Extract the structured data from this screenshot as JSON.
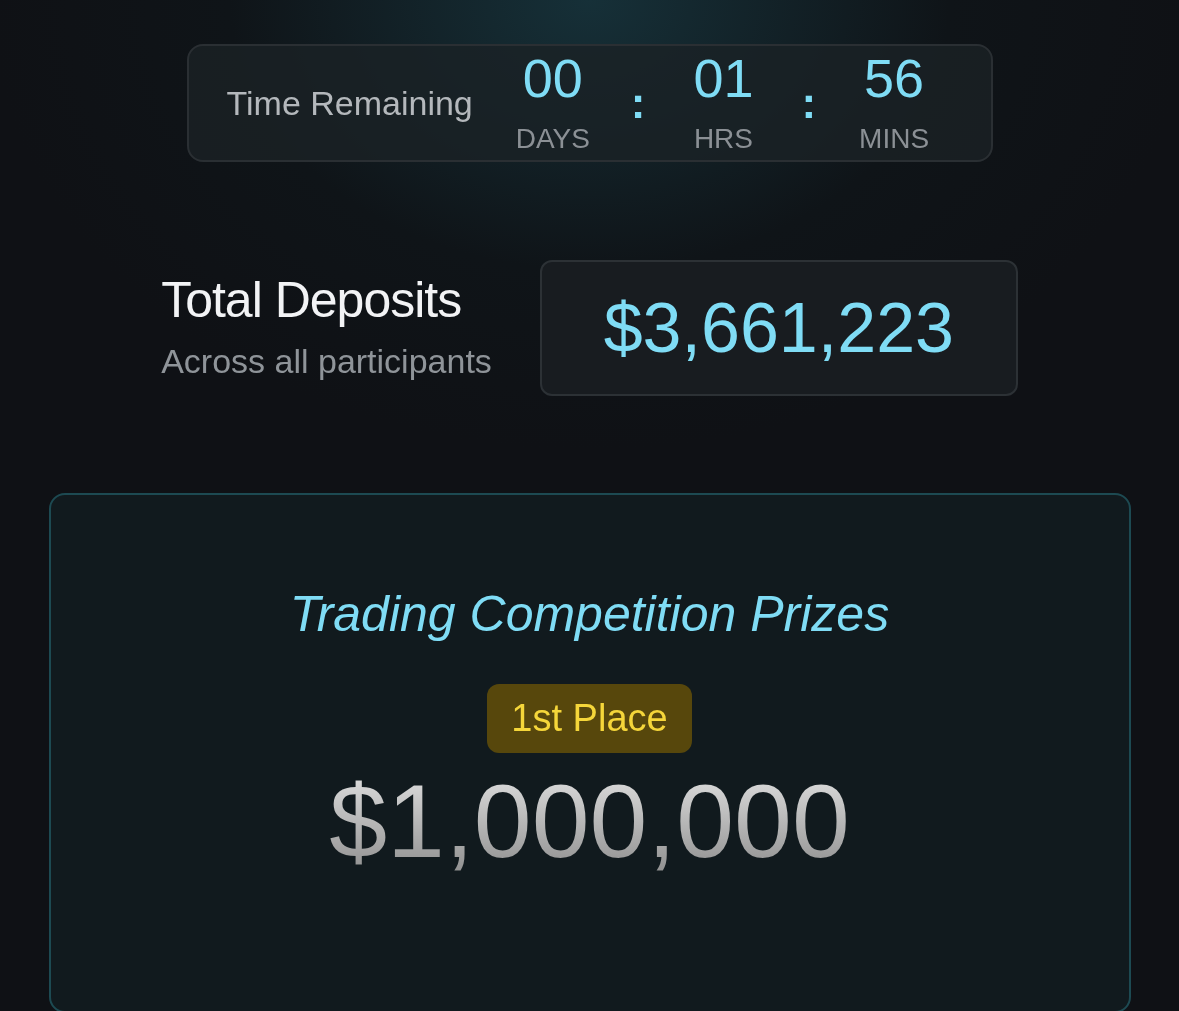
{
  "countdown": {
    "label": "Time Remaining",
    "units": [
      {
        "value": "00",
        "unit": "DAYS"
      },
      {
        "value": "01",
        "unit": "HRS"
      },
      {
        "value": "56",
        "unit": "MINS"
      }
    ],
    "separators": [
      ":",
      ":"
    ]
  },
  "deposits": {
    "title": "Total Deposits",
    "subtitle": "Across all participants",
    "amount": "$3,661,223"
  },
  "prizes": {
    "title": "Trading Competition Prizes",
    "badge": "1st Place",
    "amount": "$1,000,000"
  }
}
